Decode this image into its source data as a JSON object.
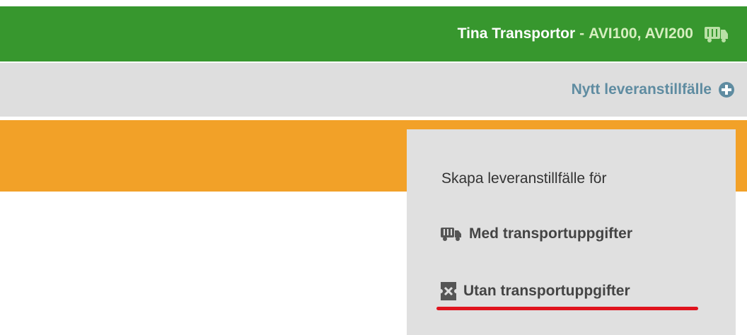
{
  "header": {
    "user_name": "Tina Transportor",
    "separator": "-",
    "codes": "AVI100, AVI200",
    "icon": "truck-icon"
  },
  "toolbar": {
    "new_occasion_label": "Nytt leveranstillfälle",
    "icon": "plus-circle-icon"
  },
  "dropdown": {
    "title": "Skapa leveranstillfälle för",
    "items": [
      {
        "label": "Med transportuppgifter",
        "icon": "truck-icon"
      },
      {
        "label": "Utan transportuppgifter",
        "icon": "no-transport-icon"
      }
    ]
  },
  "colors": {
    "header_bg": "#37972e",
    "toolbar_bg": "#dedede",
    "accent_band": "#f2a128",
    "highlight_underline": "#e0141e",
    "link": "#5f8ca1"
  }
}
